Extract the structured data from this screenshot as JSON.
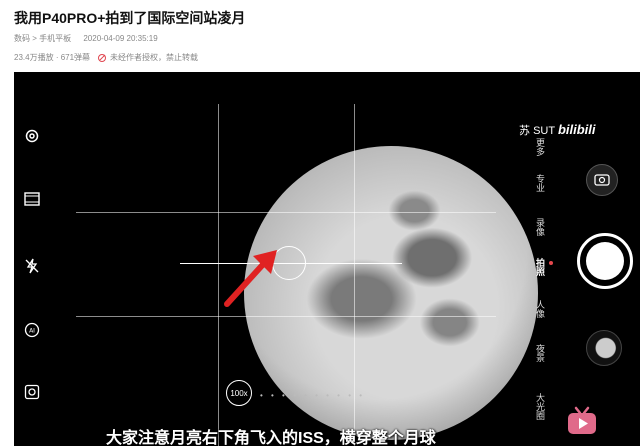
{
  "header": {
    "title": "我用P40PRO+拍到了国际空间站凌月",
    "breadcrumb": "数码 > 手机平板",
    "datetime": "2020-04-09 20:35:19",
    "views": "23.4万播放",
    "danmaku": "· 671弹幕",
    "notice": "未经作者授权，禁止转载"
  },
  "video": {
    "watermark_user": "苏",
    "watermark_user2": "SUT",
    "watermark_brand": "bilibili",
    "zoom": "100x",
    "modes": [
      "更多",
      "专业",
      "录像",
      "拍照",
      "人像",
      "夜景",
      "大光圈"
    ],
    "active_mode": "拍照",
    "subtitle": "大家注意月亮右下角飞入的ISS，横穿整个月球"
  },
  "colors": {
    "accent": "#e5484d",
    "arrow": "#e02222"
  }
}
